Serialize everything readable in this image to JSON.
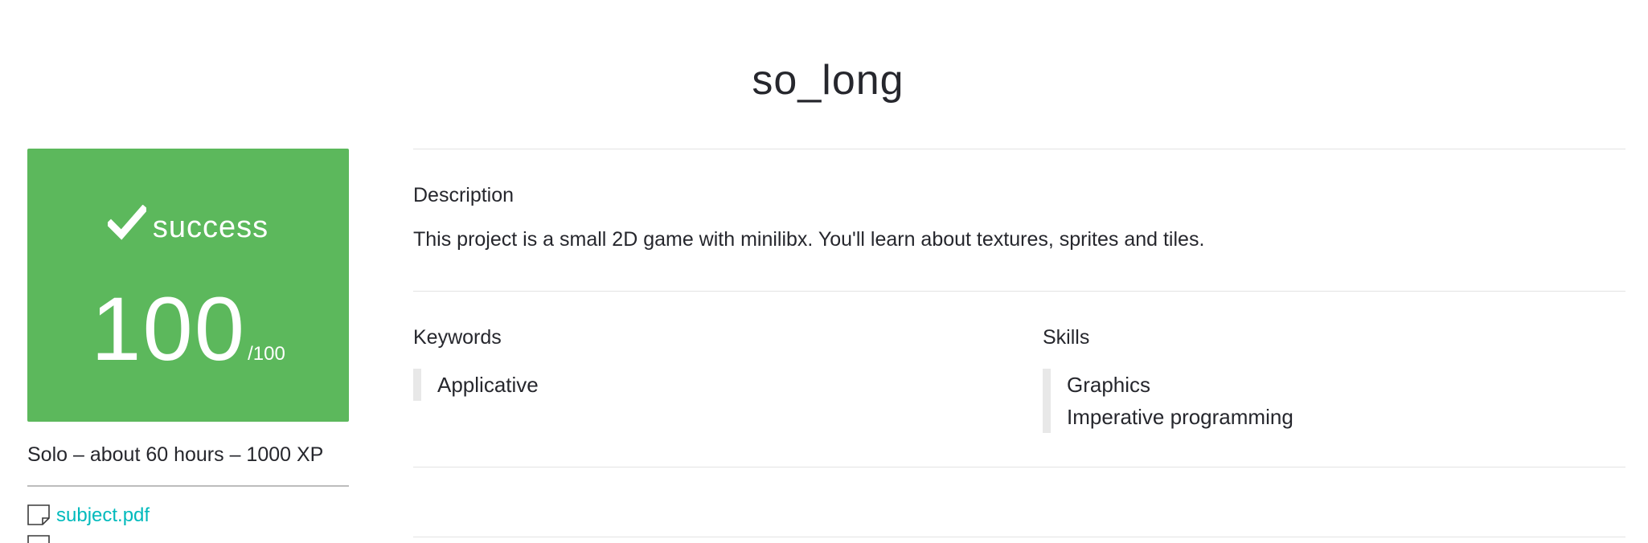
{
  "project": {
    "title": "so_long"
  },
  "status": {
    "label": "success",
    "grade": "100",
    "grade_max": "/100",
    "color": "#5cb85c",
    "icon": "check-icon"
  },
  "meta": {
    "text": "Solo – about 60 hours – 1000 XP"
  },
  "attachments": [
    {
      "label": "subject.pdf",
      "icon": "file-icon"
    }
  ],
  "description": {
    "label": "Description",
    "text": "This project is a small 2D game with minilibx. You'll learn about textures, sprites and tiles."
  },
  "keywords": {
    "label": "Keywords",
    "items": [
      "Applicative"
    ]
  },
  "skills": {
    "label": "Skills",
    "items": [
      "Graphics",
      "Imperative programming"
    ]
  },
  "colors": {
    "accent_link": "#00babc",
    "success": "#5cb85c",
    "text": "#26272d"
  }
}
